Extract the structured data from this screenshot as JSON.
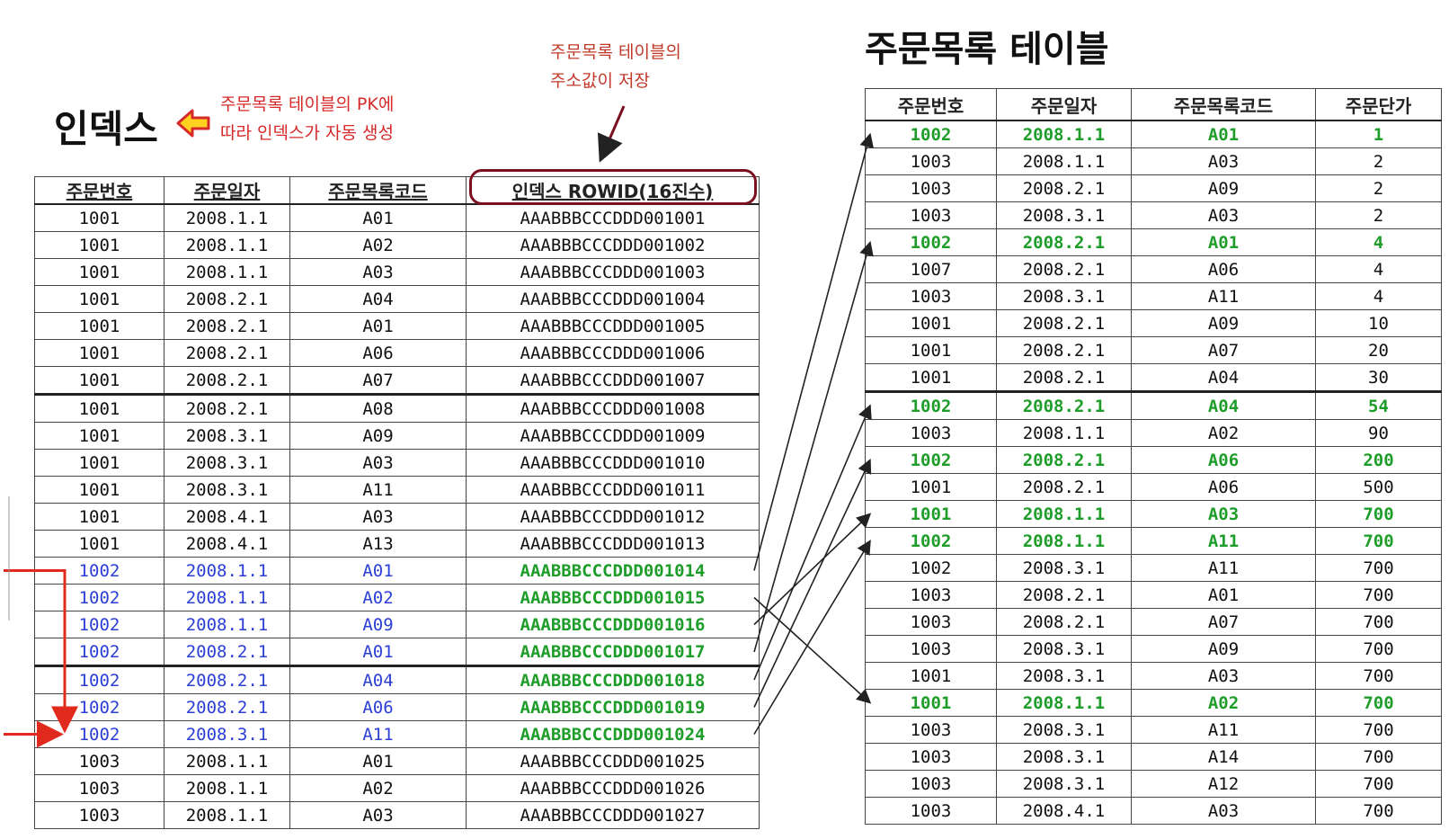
{
  "index_title": "인덱스",
  "index_note": [
    "주문목록 테이블의 PK에",
    "따라 인덱스가 자동 생성"
  ],
  "rowid_note": [
    "주문목록 테이블의",
    "주소값이 저장"
  ],
  "order_title": "주문목록 테이블",
  "colors": {
    "annotation": "#d62a2a",
    "highlight_blue": "#2b3fd6",
    "highlight_green": "#1e9d2a",
    "ring": "#7a1020"
  },
  "index_table": {
    "headers": [
      "주문번호",
      "주문일자",
      "주문목록코드",
      "인덱스 ROWID(16진수)"
    ],
    "rows": [
      [
        "1001",
        "2008.1.1",
        "A01",
        "AAABBBCCCDDD001001"
      ],
      [
        "1001",
        "2008.1.1",
        "A02",
        "AAABBBCCCDDD001002"
      ],
      [
        "1001",
        "2008.1.1",
        "A03",
        "AAABBBCCCDDD001003"
      ],
      [
        "1001",
        "2008.2.1",
        "A04",
        "AAABBBCCCDDD001004"
      ],
      [
        "1001",
        "2008.2.1",
        "A01",
        "AAABBBCCCDDD001005"
      ],
      [
        "1001",
        "2008.2.1",
        "A06",
        "AAABBBCCCDDD001006"
      ],
      [
        "1001",
        "2008.2.1",
        "A07",
        "AAABBBCCCDDD001007"
      ],
      [
        "1001",
        "2008.2.1",
        "A08",
        "AAABBBCCCDDD001008"
      ],
      [
        "1001",
        "2008.3.1",
        "A09",
        "AAABBBCCCDDD001009"
      ],
      [
        "1001",
        "2008.3.1",
        "A03",
        "AAABBBCCCDDD001010"
      ],
      [
        "1001",
        "2008.3.1",
        "A11",
        "AAABBBCCCDDD001011"
      ],
      [
        "1001",
        "2008.4.1",
        "A03",
        "AAABBBCCCDDD001012"
      ],
      [
        "1001",
        "2008.4.1",
        "A13",
        "AAABBBCCCDDD001013"
      ],
      [
        "1002",
        "2008.1.1",
        "A01",
        "AAABBBCCCDDD001014"
      ],
      [
        "1002",
        "2008.1.1",
        "A02",
        "AAABBBCCCDDD001015"
      ],
      [
        "1002",
        "2008.1.1",
        "A09",
        "AAABBBCCCDDD001016"
      ],
      [
        "1002",
        "2008.2.1",
        "A01",
        "AAABBBCCCDDD001017"
      ],
      [
        "1002",
        "2008.2.1",
        "A04",
        "AAABBBCCCDDD001018"
      ],
      [
        "1002",
        "2008.2.1",
        "A06",
        "AAABBBCCCDDD001019"
      ],
      [
        "1002",
        "2008.3.1",
        "A11",
        "AAABBBCCCDDD001024"
      ],
      [
        "1003",
        "2008.1.1",
        "A01",
        "AAABBBCCCDDD001025"
      ],
      [
        "1003",
        "2008.1.1",
        "A02",
        "AAABBBCCCDDD001026"
      ],
      [
        "1003",
        "2008.1.1",
        "A03",
        "AAABBBCCCDDD001027"
      ]
    ],
    "thick_rows": [
      7,
      17
    ],
    "highlight_rows": [
      13,
      14,
      15,
      16,
      17,
      18,
      19
    ]
  },
  "order_table": {
    "headers": [
      "주문번호",
      "주문일자",
      "주문목록코드",
      "주문단가"
    ],
    "rows": [
      [
        "1002",
        "2008.1.1",
        "A01",
        "1"
      ],
      [
        "1003",
        "2008.1.1",
        "A03",
        "2"
      ],
      [
        "1003",
        "2008.2.1",
        "A09",
        "2"
      ],
      [
        "1003",
        "2008.3.1",
        "A03",
        "2"
      ],
      [
        "1002",
        "2008.2.1",
        "A01",
        "4"
      ],
      [
        "1007",
        "2008.2.1",
        "A06",
        "4"
      ],
      [
        "1003",
        "2008.3.1",
        "A11",
        "4"
      ],
      [
        "1001",
        "2008.2.1",
        "A09",
        "10"
      ],
      [
        "1001",
        "2008.2.1",
        "A07",
        "20"
      ],
      [
        "1001",
        "2008.2.1",
        "A04",
        "30"
      ],
      [
        "1002",
        "2008.2.1",
        "A04",
        "54"
      ],
      [
        "1003",
        "2008.1.1",
        "A02",
        "90"
      ],
      [
        "1002",
        "2008.2.1",
        "A06",
        "200"
      ],
      [
        "1001",
        "2008.2.1",
        "A06",
        "500"
      ],
      [
        "1001",
        "2008.1.1",
        "A03",
        "700"
      ],
      [
        "1002",
        "2008.1.1",
        "A11",
        "700"
      ],
      [
        "1002",
        "2008.3.1",
        "A11",
        "700"
      ],
      [
        "1003",
        "2008.2.1",
        "A01",
        "700"
      ],
      [
        "1003",
        "2008.2.1",
        "A07",
        "700"
      ],
      [
        "1003",
        "2008.3.1",
        "A09",
        "700"
      ],
      [
        "1001",
        "2008.3.1",
        "A03",
        "700"
      ],
      [
        "1001",
        "2008.1.1",
        "A02",
        "700"
      ],
      [
        "1003",
        "2008.3.1",
        "A11",
        "700"
      ],
      [
        "1003",
        "2008.3.1",
        "A14",
        "700"
      ],
      [
        "1003",
        "2008.3.1",
        "A12",
        "700"
      ],
      [
        "1003",
        "2008.4.1",
        "A03",
        "700"
      ]
    ],
    "thick_rows": [
      10
    ],
    "highlight_rows": [
      0,
      4,
      10,
      12,
      14,
      15,
      21
    ]
  },
  "links": [
    [
      13,
      0
    ],
    [
      14,
      21
    ],
    [
      15,
      14
    ],
    [
      16,
      4
    ],
    [
      17,
      10
    ],
    [
      18,
      12
    ],
    [
      19,
      15
    ]
  ]
}
